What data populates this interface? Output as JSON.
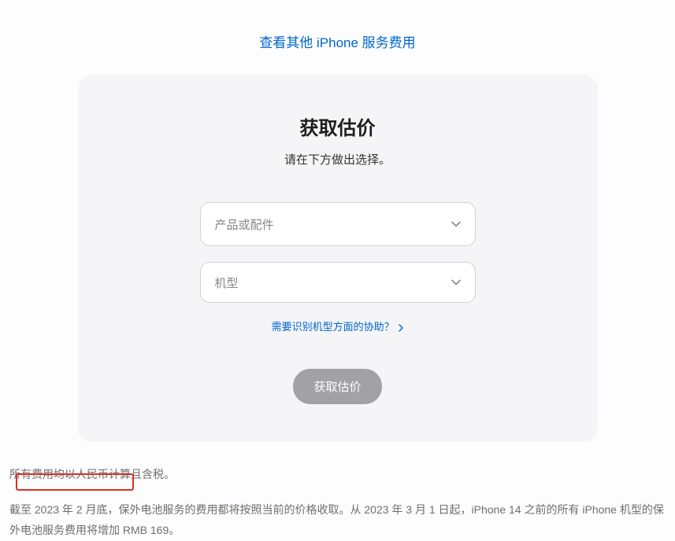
{
  "topLink": {
    "label": "查看其他 iPhone 服务费用"
  },
  "card": {
    "title": "获取估价",
    "subtitle": "请在下方做出选择。",
    "select1": {
      "placeholder": "产品或配件"
    },
    "select2": {
      "placeholder": "机型"
    },
    "helpLink": {
      "label": "需要识别机型方面的协助？"
    },
    "submit": {
      "label": "获取估价"
    }
  },
  "footer": {
    "line1": "所有费用均以人民币计算且含税。",
    "line2": "截至 2023 年 2 月底，保外电池服务的费用都将按照当前的价格收取。从 2023 年 3 月 1 日起，iPhone 14 之前的所有 iPhone 机型的保外电池服务费用将增加 RMB 169。"
  }
}
